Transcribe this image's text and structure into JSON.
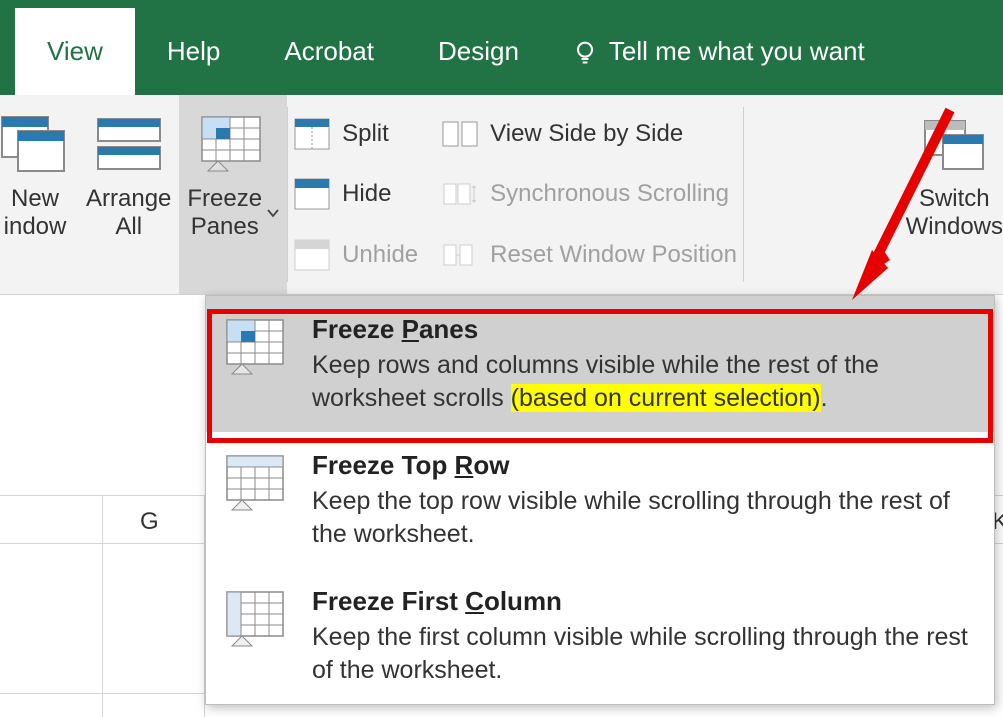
{
  "tabs": {
    "view": "View",
    "help": "Help",
    "acrobat": "Acrobat",
    "design": "Design",
    "tellme": "Tell me what you want"
  },
  "ribbon": {
    "new_window_l1": "New",
    "new_window_l2": "indow",
    "arrange_l1": "Arrange",
    "arrange_l2": "All",
    "freeze_l1": "Freeze",
    "freeze_l2": "Panes",
    "split": "Split",
    "hide": "Hide",
    "unhide": "Unhide",
    "side_by_side": "View Side by Side",
    "sync_scroll": "Synchronous Scrolling",
    "reset_pos": "Reset Window Position",
    "switch_l1": "Switch",
    "switch_l2": "Windows"
  },
  "menu": {
    "fp_title_pre": "Freeze ",
    "fp_title_u": "P",
    "fp_title_post": "anes",
    "fp_desc_a": "Keep rows and columns visible while the rest of the worksheet scrolls ",
    "fp_desc_hl": "(based on current selection)",
    "fp_desc_b": ".",
    "tr_title_pre": "Freeze Top ",
    "tr_title_u": "R",
    "tr_title_post": "ow",
    "tr_desc": "Keep the top row visible while scrolling through the rest of the worksheet.",
    "fc_title_pre": "Freeze First ",
    "fc_title_u": "C",
    "fc_title_post": "olumn",
    "fc_desc": "Keep the first column visible while scrolling through the rest of the worksheet."
  },
  "cols": {
    "g": "G",
    "k": "K"
  }
}
